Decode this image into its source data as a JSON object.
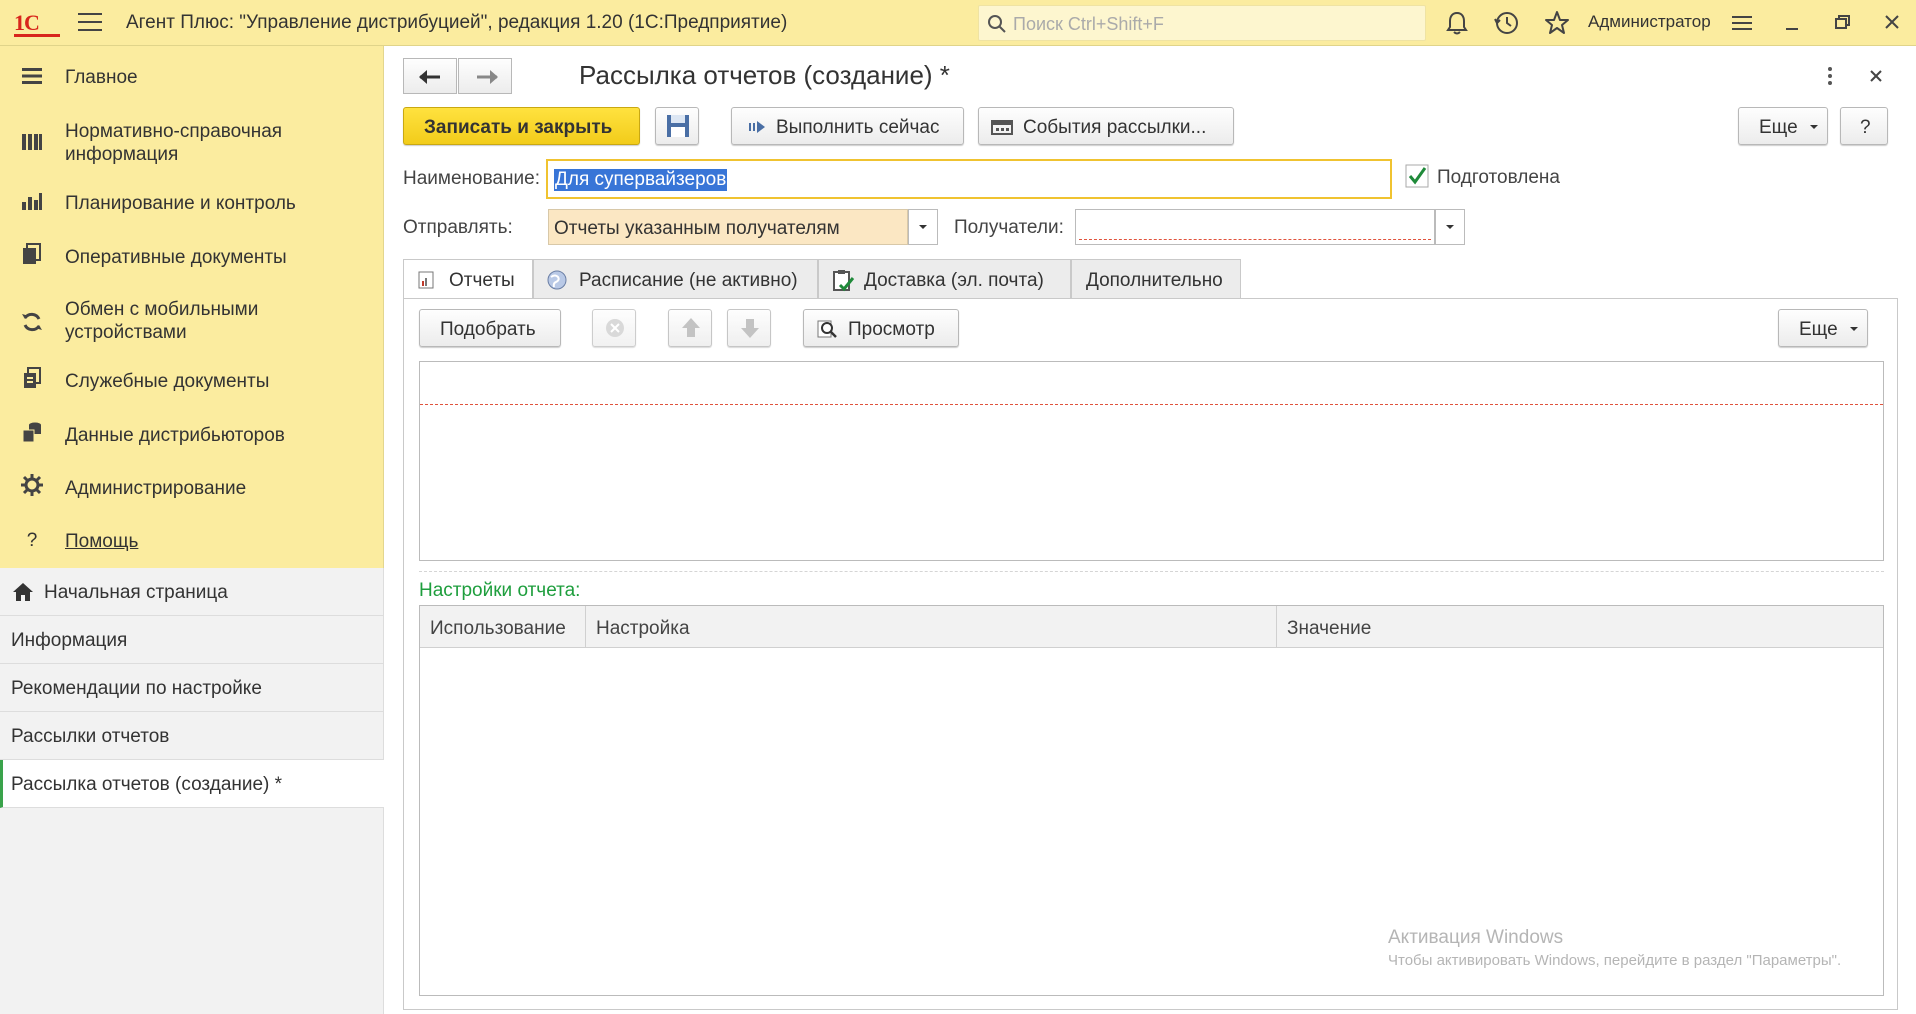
{
  "app": {
    "logo": "1С",
    "title": "Агент Плюс: \"Управление дистрибуцией\", редакция 1.20  (1С:Предприятие)",
    "search_placeholder": "Поиск Ctrl+Shift+F",
    "user": "Администратор"
  },
  "sidebar": {
    "items": [
      {
        "label": "Главное",
        "icon": "menu-lines-icon"
      },
      {
        "label": "Нормативно-справочная\nинформация",
        "icon": "bar-chart-icon"
      },
      {
        "label": "Планирование и контроль",
        "icon": "stats-icon"
      },
      {
        "label": "Оперативные документы",
        "icon": "documents-icon"
      },
      {
        "label": "Обмен с мобильными\nустройствами",
        "icon": "sync-icon"
      },
      {
        "label": "Служебные документы",
        "icon": "service-docs-icon"
      },
      {
        "label": "Данные дистрибьюторов",
        "icon": "distributor-data-icon"
      },
      {
        "label": "Администрирование",
        "icon": "gear-icon"
      },
      {
        "label": "Помощь",
        "icon": "help-icon"
      }
    ]
  },
  "open_windows": [
    {
      "label": "Начальная страница"
    },
    {
      "label": "Информация"
    },
    {
      "label": "Рекомендации по настройке"
    },
    {
      "label": "Рассылки отчетов"
    },
    {
      "label": "Рассылка отчетов (создание) *"
    }
  ],
  "form": {
    "title": "Рассылка отчетов (создание) *",
    "toolbar": {
      "save_close": "Записать и закрыть",
      "run_now": "Выполнить сейчас",
      "events": "События рассылки...",
      "more": "Еще",
      "help": "?"
    },
    "name_label": "Наименование:",
    "name_value": "Для супервайзеров",
    "prepared_label": "Подготовлена",
    "send_label": "Отправлять:",
    "send_value": "Отчеты указанным получателям",
    "recipients_label": "Получатели:",
    "recipients_value": "",
    "tabs": [
      {
        "label": "Отчеты"
      },
      {
        "label": "Расписание (не активно)"
      },
      {
        "label": "Доставка (эл. почта)"
      },
      {
        "label": "Дополнительно"
      }
    ],
    "reports_toolbar": {
      "pick": "Подобрать",
      "preview": "Просмотр",
      "more": "Еще"
    },
    "settings_caption": "Настройки отчета:",
    "settings_columns": [
      "Использование",
      "Настройка",
      "Значение"
    ]
  },
  "watermark": {
    "line1": "Активация Windows",
    "line2": "Чтобы активировать Windows, перейдите в раздел \"Параметры\"."
  },
  "colors": {
    "topbar": "#FBEC9F",
    "primary_button": "#F2CC1A",
    "accent_green": "#3AA34B",
    "selection": "#3875D7"
  }
}
